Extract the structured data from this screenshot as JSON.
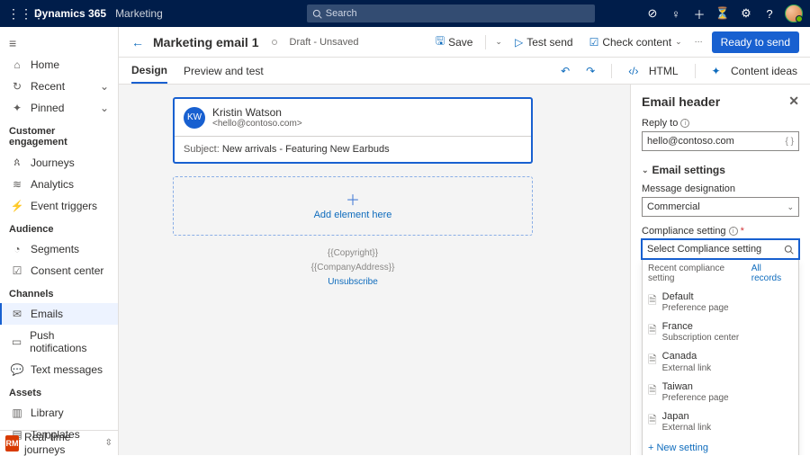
{
  "topnav": {
    "brand": "Dynamics 365",
    "sub": "Marketing",
    "search_placeholder": "Search"
  },
  "sidebar": {
    "home": "Home",
    "recent": "Recent",
    "pinned": "Pinned",
    "groups": {
      "engagement": "Customer engagement",
      "audience": "Audience",
      "channels": "Channels",
      "assets": "Assets"
    },
    "items": {
      "journeys": "Journeys",
      "analytics": "Analytics",
      "event_triggers": "Event triggers",
      "segments": "Segments",
      "consent": "Consent center",
      "emails": "Emails",
      "push": "Push notifications",
      "text": "Text messages",
      "library": "Library",
      "templates": "Templates"
    },
    "area": "Real-time journeys",
    "area_abbr": "RM"
  },
  "cmd": {
    "title": "Marketing email 1",
    "status": "Draft - Unsaved",
    "save": "Save",
    "test": "Test send",
    "check": "Check content",
    "ready": "Ready to send"
  },
  "tabs": {
    "design": "Design",
    "preview": "Preview and test",
    "html": "HTML",
    "ideas": "Content ideas"
  },
  "canvas": {
    "sender_initials": "KW",
    "sender_name": "Kristin Watson",
    "sender_email": "<hello@contoso.com>",
    "subject_label": "Subject:",
    "subject": "New arrivals - Featuring New Earbuds",
    "add": "Add element here",
    "copyright": "{{Copyright}}",
    "address": "{{CompanyAddress}}",
    "unsub": "Unsubscribe"
  },
  "panel": {
    "title": "Email header",
    "reply_label": "Reply to",
    "reply_value": "hello@contoso.com",
    "settings": "Email settings",
    "designation_label": "Message designation",
    "designation_value": "Commercial",
    "compliance_label": "Compliance setting",
    "compliance_placeholder": "Select Compliance setting",
    "recent": "Recent compliance setting",
    "all": "All records",
    "options": [
      {
        "t": "Default",
        "s": "Preference page"
      },
      {
        "t": "France",
        "s": "Subscription center"
      },
      {
        "t": "Canada",
        "s": "External link"
      },
      {
        "t": "Taiwan",
        "s": "Preference page"
      },
      {
        "t": "Japan",
        "s": "External link"
      }
    ],
    "new": "+ New setting"
  }
}
